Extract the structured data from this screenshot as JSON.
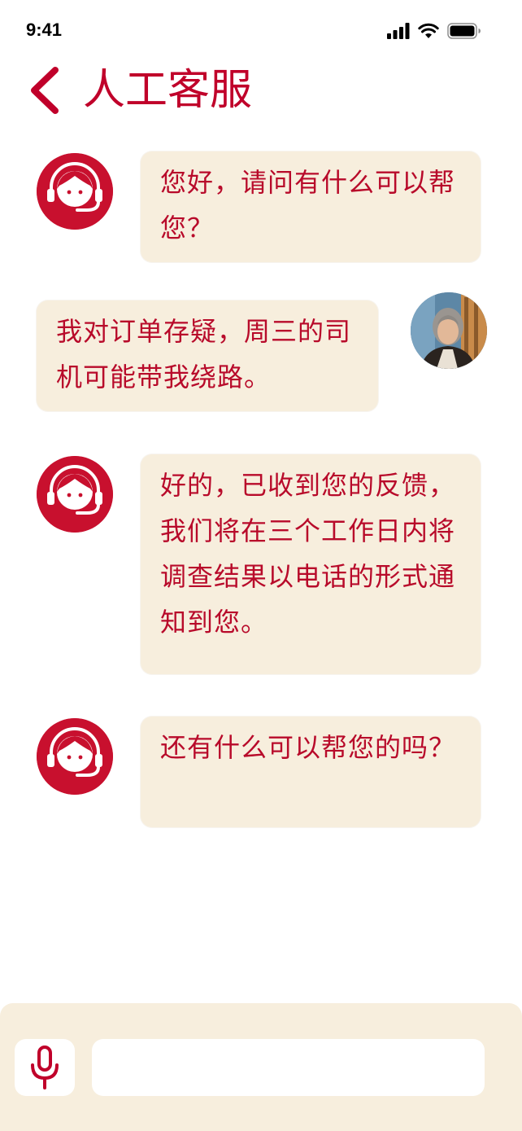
{
  "status_bar": {
    "time": "9:41"
  },
  "header": {
    "title": "人工客服",
    "back_icon": "chevron-left-icon"
  },
  "colors": {
    "accent": "#c0002a",
    "bubble": "#f7eedd",
    "panel": "#f7eedd"
  },
  "messages": [
    {
      "sender": "agent",
      "text": "您好，请问有什么可以帮您？"
    },
    {
      "sender": "user",
      "text": "我对订单存疑，周三的司机可能带我绕路。"
    },
    {
      "sender": "agent",
      "text": "好的，已收到您的反馈，我们将在三个工作日内将调查结果以电话的形式通知到您。"
    },
    {
      "sender": "agent",
      "text": "还有什么可以帮您的吗？"
    }
  ],
  "input_bar": {
    "mic_icon": "microphone-icon",
    "value": "",
    "placeholder": ""
  }
}
